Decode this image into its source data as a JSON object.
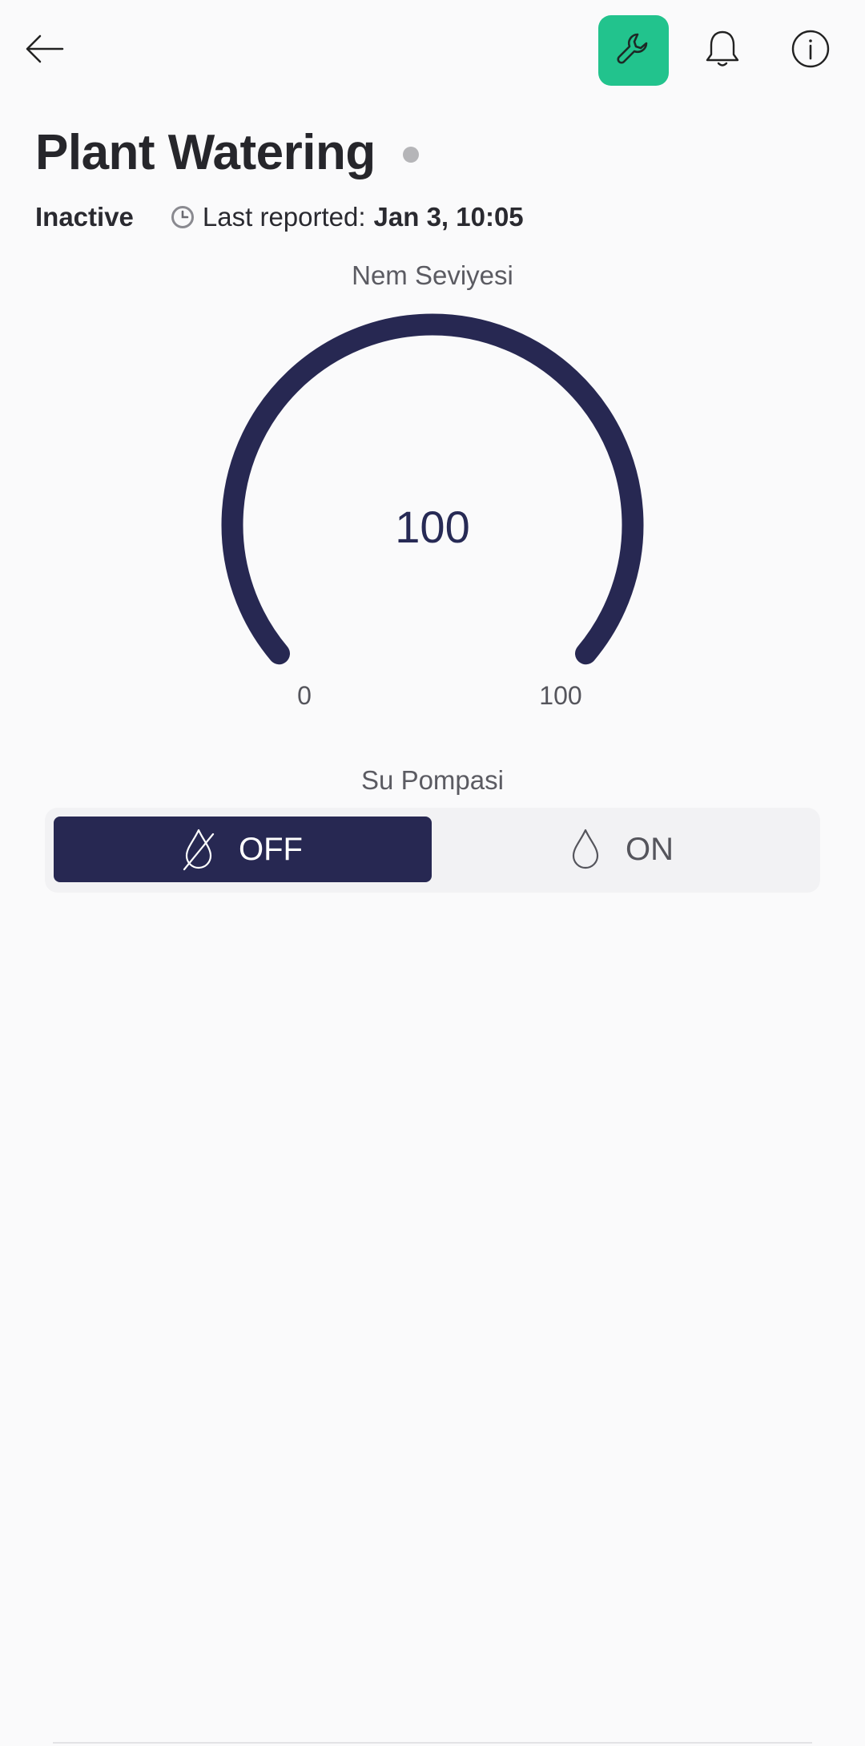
{
  "header": {
    "back_icon": "arrow-left-icon",
    "wrench_icon": "wrench-icon",
    "bell_icon": "bell-icon",
    "info_icon": "info-icon",
    "accent_color": "#22c38d"
  },
  "device": {
    "title": "Plant Watering",
    "status": "Inactive",
    "status_dot_color": "#b5b5b8",
    "last_reported_label": "Last reported:",
    "last_reported_value": "Jan 3, 10:05"
  },
  "gauge": {
    "title": "Nem Seviyesi",
    "value": "100",
    "min": "0",
    "max": "100",
    "fill_fraction": 1.0,
    "color": "#272852"
  },
  "pump": {
    "title": "Su Pompasi",
    "off_label": "OFF",
    "on_label": "ON",
    "selected": "OFF",
    "active_color": "#272852"
  }
}
